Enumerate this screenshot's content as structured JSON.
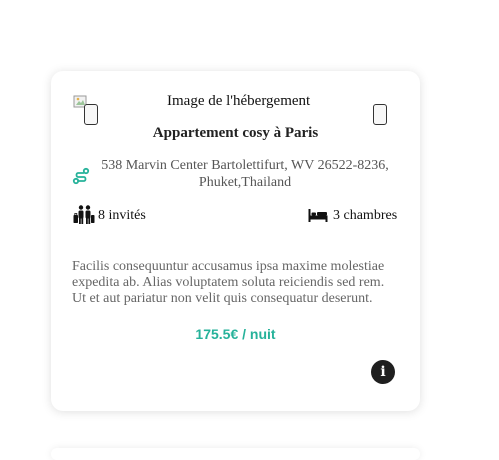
{
  "listing": {
    "image_alt": "Image de l'hébergement",
    "title": "Appartement cosy à Paris",
    "address": "538 Marvin Center Bartolettifurt, WV 26522-8236, Phuket,Thailand",
    "guests": "8 invités",
    "rooms": "3 chambres",
    "description": "Facilis consequuntur accusamus ipsa maxime molestiae expedita ab. Alias voluptatem soluta reiciendis sed rem. Ut et aut pariatur non velit quis consequatur deserunt.",
    "price": "175.5€ / nuit"
  },
  "icons": {
    "prev": "chevron-left-icon",
    "next": "chevron-right-icon",
    "location": "route-icon",
    "guests": "people-luggage-icon",
    "rooms": "bed-icon",
    "info": "info-icon",
    "broken_image": "broken-image-icon"
  },
  "colors": {
    "accent": "#26b29a",
    "info_button": "#1f1f1f",
    "text_muted": "#666666"
  }
}
